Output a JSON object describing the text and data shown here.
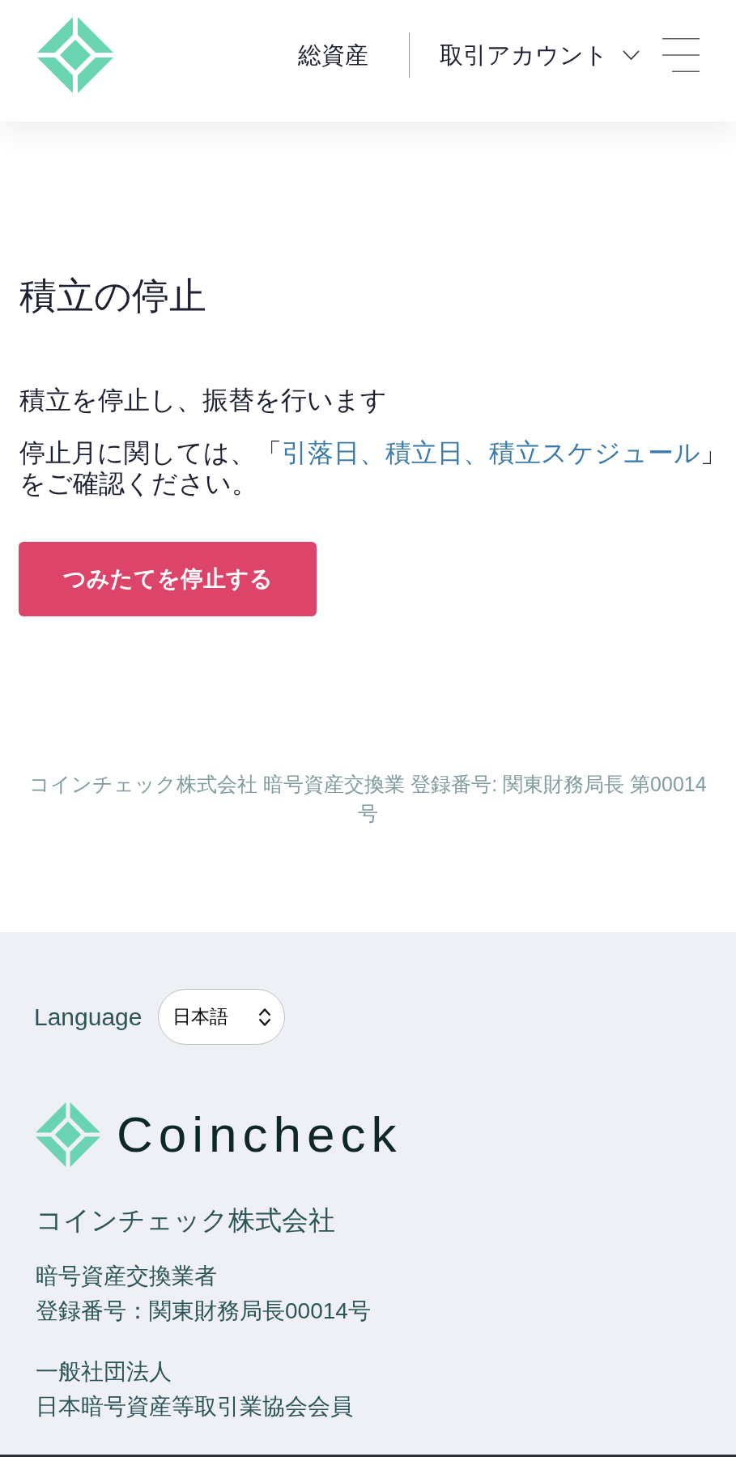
{
  "header": {
    "nav": [
      {
        "label": "総資産",
        "kind": "link"
      },
      {
        "label": "取引アカウント",
        "kind": "dropdown"
      }
    ]
  },
  "page": {
    "title": "積立の停止",
    "description": "積立を停止し、振替を行います",
    "note": {
      "before": "停止月に関しては、「",
      "link": "引落日、積立日、積立スケジュール",
      "after": "」をご確認ください。"
    },
    "button": "つみたてを停止する",
    "disclaimer": "コインチェック株式会社 暗号資産交換業 登録番号: 関東財務局長 第00014号"
  },
  "footer": {
    "language": {
      "label": "Language",
      "value": "日本語"
    },
    "brand": "Coincheck",
    "company": "コインチェック株式会社",
    "info": [
      [
        "暗号資産交換業者",
        "登録番号：関東財務局長00014号"
      ],
      [
        "一般社団法人",
        "日本暗号資産等取引業協会会員"
      ]
    ]
  }
}
